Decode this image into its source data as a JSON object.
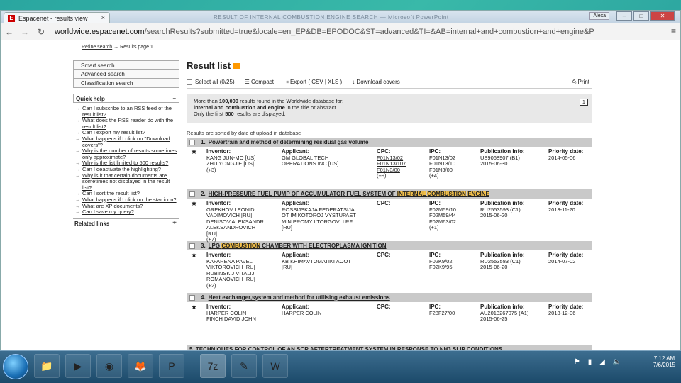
{
  "browser": {
    "tab_title": "Espacenet - results view",
    "tab_close": "×",
    "blurred_title": "RESULT OF INTERNAL COMBUSTION ENGINE SEARCH — Microsoft PowerPoint",
    "user": "Alexa",
    "min": "–",
    "max": "□",
    "close": "✕",
    "url_host": "worldwide.espacenet.com",
    "url_path": "/searchResults?submitted=true&locale=en_EP&DB=EPODOC&ST=advanced&TI=&AB=internal+and+combustion+and+engine&P"
  },
  "breadcrumb": {
    "refine": "Refine search",
    "arrow": "→",
    "page": "Results page 1"
  },
  "sidebar": {
    "nav": [
      "Smart search",
      "Advanced search",
      "Classification search"
    ],
    "quick_help": "Quick help",
    "quick_help_toggle": "−",
    "help_links": [
      "Can I subscribe to an RSS feed of the result list?",
      "What does the RSS reader do with the result list?",
      "Can I export my result list?",
      "What happens if I click on \"Download covers\"?",
      "Why is the number of results sometimes only approximate?",
      "Why is the list limited to 500 results?",
      "Can I deactivate the highlighting?",
      "Why is it that certain documents are sometimes not displayed in the result list?",
      "Can I sort the result list?",
      "What happens if I click on the star icon?",
      "What are XP documents?",
      "Can I save my query?"
    ],
    "related": "Related links",
    "related_toggle": "+"
  },
  "main": {
    "title": "Result list",
    "toolbar": {
      "select_all": "Select all",
      "count": "(0/25)",
      "compact": "Compact",
      "export": "Export ( CSV | XLS )",
      "download": "Download covers",
      "print": "Print"
    },
    "info_line1a": "More than ",
    "info_count": "100,000",
    "info_line1b": " results found in the Worldwide database for:",
    "info_line2": "internal and combustion and engine",
    "info_line2b": " in the title or abstract",
    "info_line3a": "Only the first ",
    "info_limit": "500",
    "info_line3b": " results are displayed.",
    "page_num": "1",
    "sorted": "Results are sorted by date of upload in database"
  },
  "labels": {
    "inventor": "Inventor:",
    "applicant": "Applicant:",
    "cpc": "CPC:",
    "ipc": "IPC:",
    "pub": "Publication info:",
    "priority": "Priority date:"
  },
  "results": [
    {
      "num": "1.",
      "title": "Powertrain and method of determining residual gas volume",
      "inventor": [
        "KANG JUN-MO [US]",
        "ZHU YONGJIE [US]",
        "(+3)"
      ],
      "applicant": [
        "GM GLOBAL TECH",
        "OPERATIONS INC [US]"
      ],
      "cpc": [
        "F01N13/02",
        "F01N13/107",
        "F01N3/00",
        "(+9)"
      ],
      "ipc": [
        "F01N13/02",
        "F01N13/10",
        "F01N3/00",
        "(+4)"
      ],
      "pub": [
        "US9068907 (B1)",
        "2015-06-30"
      ],
      "priority": "2014-05-06"
    },
    {
      "num": "2.",
      "title_parts": [
        "HIGH-PRESSURE FUEL PUMP OF ACCUMULATOR FUEL SYSTEM OF ",
        "INTERNAL",
        " ",
        "COMBUSTION",
        " ",
        "ENGINE"
      ],
      "inventor": [
        "GREKHOV LEONID",
        "VADIMOVICH [RU]",
        "DENISOV ALEKSANDR",
        "ALEKSANDROVICH",
        "[RU]",
        "(+7)"
      ],
      "applicant": [
        "ROSSIJSKAJA FEDERATSIJA",
        "OT IM KOTOROJ VYSTUPAET",
        "MIN PROMY I TORGOVLI RF",
        "[RU]"
      ],
      "cpc": [],
      "ipc": [
        "F02M59/10",
        "F02M59/44",
        "F02M63/02",
        "(+1)"
      ],
      "pub": [
        "RU2553593 (C1)",
        "2015-06-20"
      ],
      "priority": "2013-11-20"
    },
    {
      "num": "3.",
      "title_parts": [
        "LPG ",
        "COMBUSTION",
        " CHAMBER WITH ELECTROPLASMA IGNITION"
      ],
      "inventor": [
        "KAFARENA PAVEL",
        "VIKTOROVICH [RU]",
        "RUBINSKIJ VITALIJ",
        "ROMANOVICH [RU]",
        "(+2)"
      ],
      "applicant": [
        "KB KHIMAVTOMATIKI AOOT",
        "[RU]"
      ],
      "cpc": [],
      "ipc": [
        "F02K9/02",
        "F02K9/95"
      ],
      "pub": [
        "RU2553583 (C1)",
        "2015-06-20"
      ],
      "priority": "2014-07-02"
    },
    {
      "num": "4.",
      "title": "Heat exchanger,system and method for utilising exhaust emissions",
      "inventor": [
        "HARPER COLIN",
        "FINCH DAVID JOHN"
      ],
      "applicant": [
        "HARPER COLIN"
      ],
      "cpc": [],
      "ipc": [
        "F28F27/00"
      ],
      "pub": [
        "AU2013267075 (A1)",
        "2015-06-25"
      ],
      "priority": "2013-12-06"
    }
  ],
  "partial_result": "5.  TECHNIQUES FOR CONTROL OF AN SCR AFTERTREATMENT SYSTEM IN RESPONSE TO NH3 SLIP CONDITIONS",
  "taskbar": {
    "time": "7:12 AM",
    "date": "7/6/2015"
  }
}
